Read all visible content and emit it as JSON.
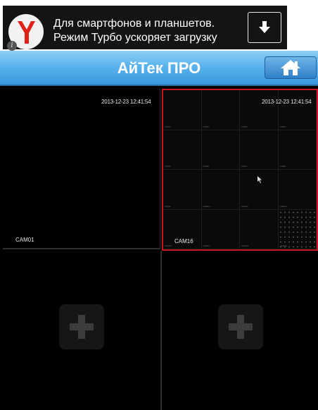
{
  "ad": {
    "line1": "Для смартфонов и планшетов.",
    "line2": "Режим Турбо ускоряет загрузку",
    "info_glyph": "i",
    "logo_icon": "yandex-browser-icon",
    "download_icon": "download-arrow-icon"
  },
  "titlebar": {
    "title": "АйТек ПРО",
    "home_icon": "home-icon"
  },
  "cameras": [
    {
      "label": "CAM01",
      "timestamp": "2013-12-23 12:41:54"
    },
    {
      "label": "CAM16",
      "timestamp": "2013-12-23 12:41:54"
    }
  ],
  "colors": {
    "accent": "#3a9ae0",
    "selected_border": "#c4161c"
  }
}
